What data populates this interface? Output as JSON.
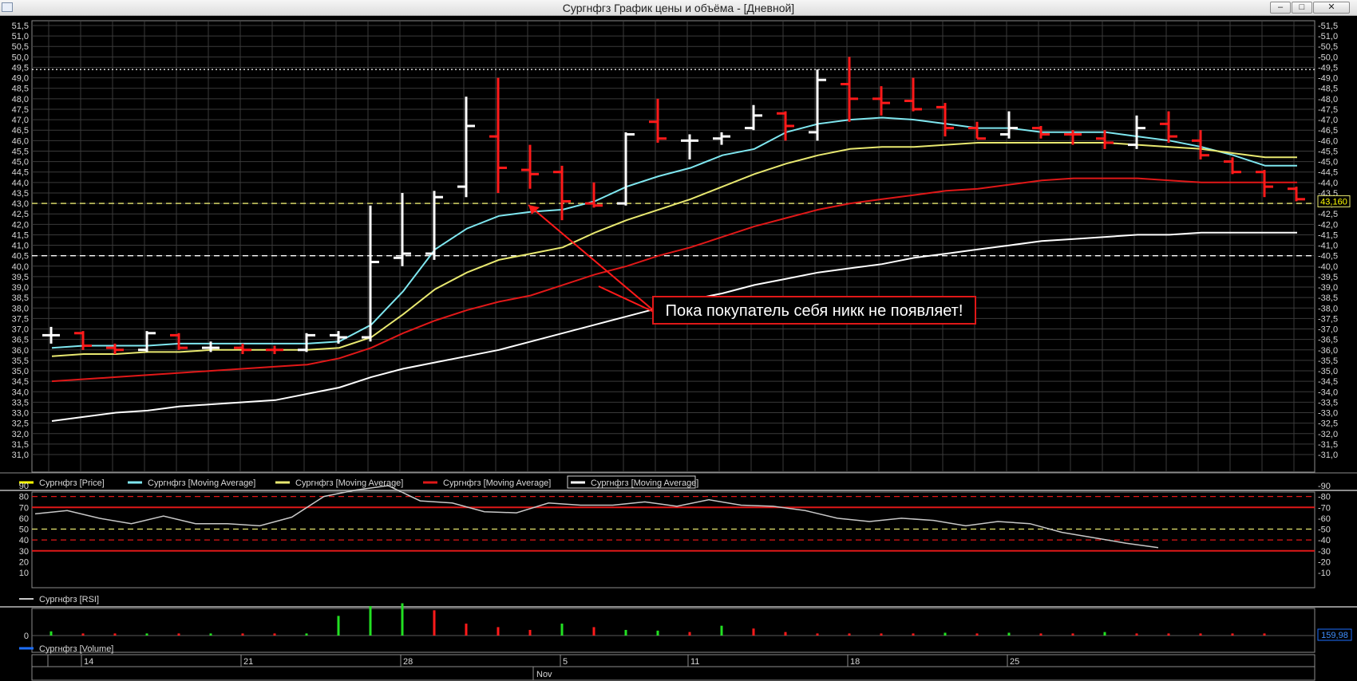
{
  "window": {
    "title": "Сургнфгз График цены и объёма - [Дневной]",
    "minimize_glyph": "–",
    "maximize_glyph": "□",
    "close_glyph": "✕"
  },
  "annotation": {
    "text": "Пока покупатель себя никк не появляет!"
  },
  "legend": [
    {
      "label": "Сургнфгз [Price]",
      "color": "#ffff00"
    },
    {
      "label": "Сургнфгз [Moving Average]",
      "color": "#7fe7f0"
    },
    {
      "label": "Сургнфгз [Moving Average]",
      "color": "#e8e870"
    },
    {
      "label": "Сургнфгз [Moving Average]",
      "color": "#e01818"
    },
    {
      "label": "Сургнфгз [Moving Average]",
      "color": "#ffffff"
    }
  ],
  "rsi_legend": {
    "label": "Сургнфгз [RSI]",
    "color": "#c8c8c8"
  },
  "volume_legend": {
    "label": "Сургнфгз [Volume]",
    "color": "#1e6fff"
  },
  "last_price_label": "43,160",
  "last_volume_label": "159,98",
  "chart_data": [
    {
      "type": "ohlc",
      "name": "Сургнфгз [Price]",
      "ylim": [
        31,
        51.5
      ],
      "y_ticks": [
        "31,0",
        "31,5",
        "32,0",
        "32,5",
        "33,0",
        "33,5",
        "34,0",
        "34,5",
        "35,0",
        "35,5",
        "36,0",
        "36,5",
        "37,0",
        "37,5",
        "38,0",
        "38,5",
        "39,0",
        "39,5",
        "40,0",
        "40,5",
        "41,0",
        "41,5",
        "42,0",
        "42,5",
        "43,0",
        "43,5",
        "44,0",
        "44,5",
        "45,0",
        "45,5",
        "46,0",
        "46,5",
        "47,0",
        "47,5",
        "48,0",
        "48,5",
        "49,0",
        "49,5",
        "50,0",
        "50,5",
        "51,0",
        "51,5"
      ],
      "x_labels": [
        {
          "bar": 1.5,
          "text": "14"
        },
        {
          "bar": 6.5,
          "text": "21"
        },
        {
          "bar": 11.5,
          "text": "28"
        },
        {
          "bar": 16.5,
          "text": "5"
        },
        {
          "bar": 20.5,
          "text": "11"
        },
        {
          "bar": 25.5,
          "text": "18"
        },
        {
          "bar": 30.5,
          "text": "25"
        }
      ],
      "month_label": {
        "bar": 15.1,
        "text": "Nov"
      },
      "bars": [
        {
          "o": 36.7,
          "h": 37.1,
          "l": 36.3,
          "c": 36.7,
          "up": true
        },
        {
          "o": 36.8,
          "h": 36.9,
          "l": 36.0,
          "c": 36.2,
          "up": false
        },
        {
          "o": 36.1,
          "h": 36.3,
          "l": 35.8,
          "c": 36.0,
          "up": false
        },
        {
          "o": 36.0,
          "h": 36.9,
          "l": 35.9,
          "c": 36.8,
          "up": true
        },
        {
          "o": 36.7,
          "h": 36.8,
          "l": 36.0,
          "c": 36.1,
          "up": false
        },
        {
          "o": 36.1,
          "h": 36.4,
          "l": 35.9,
          "c": 36.1,
          "up": true
        },
        {
          "o": 36.1,
          "h": 36.3,
          "l": 35.8,
          "c": 36.0,
          "up": false
        },
        {
          "o": 36.0,
          "h": 36.2,
          "l": 35.8,
          "c": 36.0,
          "up": false
        },
        {
          "o": 36.0,
          "h": 36.8,
          "l": 35.9,
          "c": 36.7,
          "up": true
        },
        {
          "o": 36.7,
          "h": 36.9,
          "l": 36.3,
          "c": 36.6,
          "up": true
        },
        {
          "o": 36.6,
          "h": 42.9,
          "l": 36.4,
          "c": 40.2,
          "up": true
        },
        {
          "o": 40.4,
          "h": 43.5,
          "l": 40.0,
          "c": 40.6,
          "up": true
        },
        {
          "o": 40.6,
          "h": 43.6,
          "l": 40.3,
          "c": 43.3,
          "up": true
        },
        {
          "o": 43.8,
          "h": 48.1,
          "l": 43.3,
          "c": 46.7,
          "up": true
        },
        {
          "o": 46.2,
          "h": 49.0,
          "l": 43.5,
          "c": 44.7,
          "up": false
        },
        {
          "o": 44.6,
          "h": 45.8,
          "l": 43.7,
          "c": 44.4,
          "up": false
        },
        {
          "o": 44.5,
          "h": 44.8,
          "l": 42.2,
          "c": 43.1,
          "up": false
        },
        {
          "o": 43.0,
          "h": 44.0,
          "l": 42.8,
          "c": 42.9,
          "up": false
        },
        {
          "o": 43.0,
          "h": 46.4,
          "l": 42.9,
          "c": 46.3,
          "up": true
        },
        {
          "o": 46.9,
          "h": 48.0,
          "l": 45.9,
          "c": 46.1,
          "up": false
        },
        {
          "o": 46.0,
          "h": 46.3,
          "l": 45.1,
          "c": 46.0,
          "up": true
        },
        {
          "o": 46.1,
          "h": 46.4,
          "l": 45.8,
          "c": 46.2,
          "up": true
        },
        {
          "o": 46.6,
          "h": 47.7,
          "l": 46.5,
          "c": 47.2,
          "up": true
        },
        {
          "o": 47.3,
          "h": 47.4,
          "l": 46.0,
          "c": 46.7,
          "up": false
        },
        {
          "o": 46.4,
          "h": 49.4,
          "l": 46.0,
          "c": 48.9,
          "up": true
        },
        {
          "o": 48.7,
          "h": 50.0,
          "l": 46.9,
          "c": 48.0,
          "up": false
        },
        {
          "o": 48.0,
          "h": 48.6,
          "l": 47.2,
          "c": 47.8,
          "up": false
        },
        {
          "o": 47.9,
          "h": 49.0,
          "l": 47.4,
          "c": 47.5,
          "up": false
        },
        {
          "o": 47.6,
          "h": 47.8,
          "l": 46.2,
          "c": 46.6,
          "up": false
        },
        {
          "o": 46.6,
          "h": 46.9,
          "l": 46.1,
          "c": 46.1,
          "up": false
        },
        {
          "o": 46.3,
          "h": 47.4,
          "l": 46.1,
          "c": 46.6,
          "up": true
        },
        {
          "o": 46.6,
          "h": 46.7,
          "l": 46.1,
          "c": 46.3,
          "up": false
        },
        {
          "o": 46.3,
          "h": 46.5,
          "l": 45.8,
          "c": 46.3,
          "up": false
        },
        {
          "o": 46.1,
          "h": 46.5,
          "l": 45.6,
          "c": 45.9,
          "up": false
        },
        {
          "o": 45.8,
          "h": 47.2,
          "l": 45.6,
          "c": 46.6,
          "up": true
        },
        {
          "o": 46.8,
          "h": 47.4,
          "l": 45.9,
          "c": 46.2,
          "up": false
        },
        {
          "o": 46.0,
          "h": 46.5,
          "l": 45.1,
          "c": 45.3,
          "up": false
        },
        {
          "o": 45.0,
          "h": 45.2,
          "l": 44.4,
          "c": 44.5,
          "up": false
        },
        {
          "o": 44.5,
          "h": 44.6,
          "l": 43.3,
          "c": 43.8,
          "up": false
        },
        {
          "o": 43.7,
          "h": 43.8,
          "l": 43.1,
          "c": 43.2,
          "up": false
        }
      ],
      "moving_averages": [
        {
          "color": "#7fe7f0",
          "values": [
            36.1,
            36.2,
            36.2,
            36.2,
            36.3,
            36.3,
            36.3,
            36.3,
            36.3,
            36.4,
            37.2,
            38.8,
            40.8,
            41.8,
            42.4,
            42.6,
            42.7,
            43.1,
            43.8,
            44.3,
            44.7,
            45.3,
            45.6,
            46.4,
            46.8,
            47.0,
            47.1,
            47.0,
            46.8,
            46.6,
            46.6,
            46.4,
            46.4,
            46.4,
            46.2,
            46.0,
            45.7,
            45.3,
            44.8,
            44.8
          ]
        },
        {
          "color": "#e8e870",
          "values": [
            35.7,
            35.8,
            35.8,
            35.9,
            35.9,
            36.0,
            36.0,
            36.0,
            36.0,
            36.1,
            36.6,
            37.7,
            38.9,
            39.7,
            40.3,
            40.6,
            40.9,
            41.6,
            42.2,
            42.7,
            43.2,
            43.8,
            44.4,
            44.9,
            45.3,
            45.6,
            45.7,
            45.7,
            45.8,
            45.9,
            45.9,
            45.9,
            45.9,
            45.9,
            45.8,
            45.7,
            45.6,
            45.4,
            45.2,
            45.2
          ]
        },
        {
          "color": "#e01818",
          "values": [
            34.5,
            34.6,
            34.7,
            34.8,
            34.9,
            35.0,
            35.1,
            35.2,
            35.3,
            35.6,
            36.1,
            36.8,
            37.4,
            37.9,
            38.3,
            38.6,
            39.1,
            39.6,
            40.0,
            40.5,
            40.9,
            41.4,
            41.9,
            42.3,
            42.7,
            43.0,
            43.2,
            43.4,
            43.6,
            43.7,
            43.9,
            44.1,
            44.2,
            44.2,
            44.2,
            44.1,
            44.0,
            44.0,
            44.0,
            44.0
          ]
        },
        {
          "color": "#ffffff",
          "values": [
            32.6,
            32.8,
            33.0,
            33.1,
            33.3,
            33.4,
            33.5,
            33.6,
            33.9,
            34.2,
            34.7,
            35.1,
            35.4,
            35.7,
            36.0,
            36.4,
            36.8,
            37.2,
            37.6,
            38.0,
            38.4,
            38.7,
            39.1,
            39.4,
            39.7,
            39.9,
            40.1,
            40.4,
            40.6,
            40.8,
            41.0,
            41.2,
            41.3,
            41.4,
            41.5,
            41.5,
            41.6,
            41.6,
            41.6,
            41.6
          ]
        }
      ],
      "horizontal_lines": [
        {
          "value": 49.4,
          "color": "#ffffff",
          "style": "dotted"
        },
        {
          "value": 43.0,
          "color": "#e8e870",
          "style": "dashed"
        },
        {
          "value": 40.5,
          "color": "#ffffff",
          "style": "dashed"
        }
      ]
    },
    {
      "type": "line",
      "name": "Сургнфгз [RSI]",
      "ylim": [
        10,
        90
      ],
      "y_ticks": [
        "10",
        "20",
        "30",
        "40",
        "50",
        "60",
        "70",
        "80",
        "90"
      ],
      "values": [
        64,
        67,
        60,
        55,
        62,
        55,
        55,
        53,
        61,
        80,
        86,
        90,
        76,
        74,
        66,
        65,
        74,
        72,
        72,
        75,
        71,
        77,
        72,
        71,
        67,
        60,
        57,
        60,
        58,
        53,
        57,
        55,
        47,
        42,
        37,
        33
      ],
      "levels": [
        {
          "value": 80,
          "color": "#e01818",
          "style": "dashed"
        },
        {
          "value": 70,
          "color": "#e01818",
          "style": "solid"
        },
        {
          "value": 50,
          "color": "#e8e870",
          "style": "dashed"
        },
        {
          "value": 40,
          "color": "#e01818",
          "style": "dashed"
        },
        {
          "value": 30,
          "color": "#e01818",
          "style": "solid"
        }
      ]
    },
    {
      "type": "bar",
      "name": "Сургнфгз [Volume]",
      "y_ticks": [
        "0"
      ],
      "values": [
        6,
        3,
        3,
        3,
        3,
        3,
        3,
        3,
        3,
        28,
        42,
        46,
        36,
        17,
        12,
        8,
        17,
        12,
        8,
        7,
        5,
        14,
        10,
        5,
        3,
        3,
        3,
        3,
        4,
        3,
        4,
        3,
        3,
        5,
        3,
        3,
        3,
        3,
        3
      ],
      "up": [
        true,
        false,
        false,
        true,
        false,
        true,
        false,
        false,
        true,
        true,
        true,
        true,
        false,
        false,
        false,
        false,
        true,
        false,
        true,
        true,
        false,
        true,
        false,
        false,
        false,
        false,
        false,
        false,
        true,
        false,
        true,
        false,
        false,
        true,
        false,
        false,
        false,
        false,
        false
      ]
    }
  ]
}
